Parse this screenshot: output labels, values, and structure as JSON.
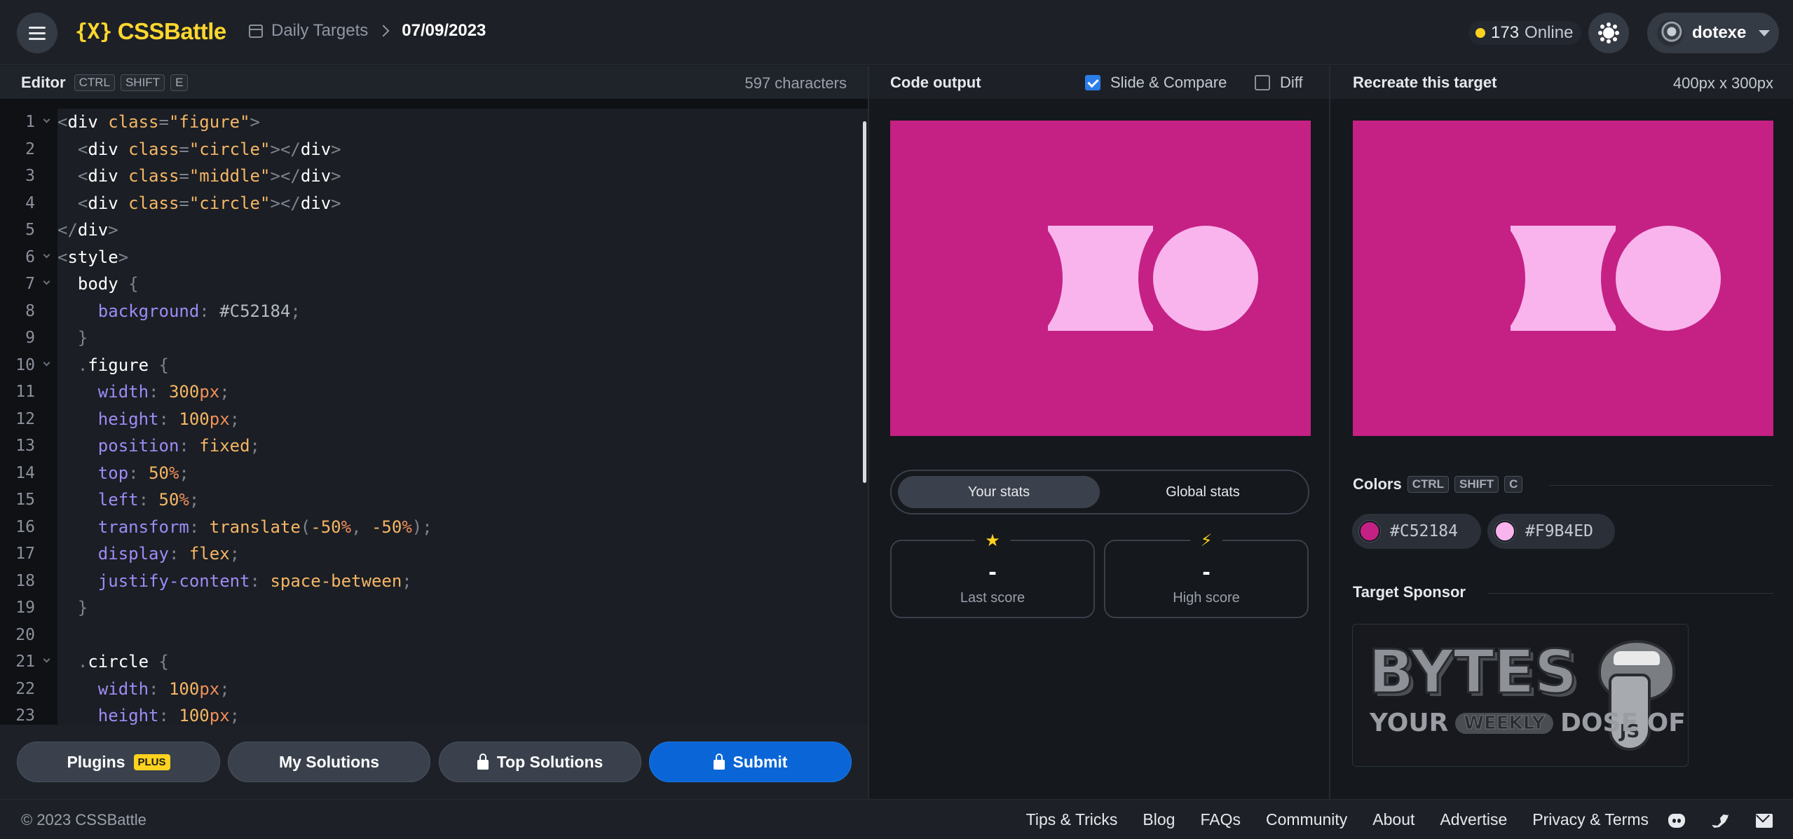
{
  "app": {
    "logo_text": "CSSBattle",
    "logo_mark": "{X}"
  },
  "header": {
    "breadcrumb_section": "Daily Targets",
    "breadcrumb_current": "07/09/2023",
    "online_count": "173",
    "online_label": "Online",
    "username": "dotexe"
  },
  "editor": {
    "title": "Editor",
    "shortcut_keys": [
      "CTRL",
      "SHIFT",
      "E"
    ],
    "char_count": "597 characters",
    "line_numbers": [
      "1",
      "2",
      "3",
      "4",
      "5",
      "6",
      "7",
      "8",
      "9",
      "10",
      "11",
      "12",
      "13",
      "14",
      "15",
      "16",
      "17",
      "18",
      "19",
      "20",
      "21",
      "22",
      "23"
    ],
    "lines": [
      {
        "tokens": [
          [
            "t-punc",
            "<"
          ],
          [
            "t-tag",
            "div "
          ],
          [
            "t-attr",
            "class"
          ],
          [
            "t-punc",
            "="
          ],
          [
            "t-str",
            "\"figure\""
          ],
          [
            "t-punc",
            ">"
          ]
        ]
      },
      {
        "tokens": [
          [
            "t-punc",
            "  <"
          ],
          [
            "t-tag",
            "div "
          ],
          [
            "t-attr",
            "class"
          ],
          [
            "t-punc",
            "="
          ],
          [
            "t-str",
            "\"circle\""
          ],
          [
            "t-punc",
            "></"
          ],
          [
            "t-tag",
            "div"
          ],
          [
            "t-punc",
            ">"
          ]
        ]
      },
      {
        "tokens": [
          [
            "t-punc",
            "  <"
          ],
          [
            "t-tag",
            "div "
          ],
          [
            "t-attr",
            "class"
          ],
          [
            "t-punc",
            "="
          ],
          [
            "t-str",
            "\"middle\""
          ],
          [
            "t-punc",
            "></"
          ],
          [
            "t-tag",
            "div"
          ],
          [
            "t-punc",
            ">"
          ]
        ]
      },
      {
        "tokens": [
          [
            "t-punc",
            "  <"
          ],
          [
            "t-tag",
            "div "
          ],
          [
            "t-attr",
            "class"
          ],
          [
            "t-punc",
            "="
          ],
          [
            "t-str",
            "\"circle\""
          ],
          [
            "t-punc",
            "></"
          ],
          [
            "t-tag",
            "div"
          ],
          [
            "t-punc",
            ">"
          ]
        ]
      },
      {
        "tokens": [
          [
            "t-punc",
            "</"
          ],
          [
            "t-tag",
            "div"
          ],
          [
            "t-punc",
            ">"
          ]
        ]
      },
      {
        "tokens": [
          [
            "t-punc",
            "<"
          ],
          [
            "t-tag",
            "style"
          ],
          [
            "t-punc",
            ">"
          ]
        ]
      },
      {
        "tokens": [
          [
            "t-sel",
            "  body "
          ],
          [
            "t-punc",
            "{"
          ]
        ]
      },
      {
        "tokens": [
          [
            "t-prop",
            "    background"
          ],
          [
            "t-punc",
            ": "
          ],
          [
            "t-hex",
            "#C52184"
          ],
          [
            "t-punc",
            ";"
          ]
        ]
      },
      {
        "tokens": [
          [
            "t-punc",
            "  }"
          ]
        ]
      },
      {
        "tokens": [
          [
            "t-punc",
            "  ."
          ],
          [
            "t-sel",
            "figure "
          ],
          [
            "t-punc",
            "{"
          ]
        ]
      },
      {
        "tokens": [
          [
            "t-prop",
            "    width"
          ],
          [
            "t-punc",
            ": "
          ],
          [
            "t-num",
            "300"
          ],
          [
            "t-unit",
            "px"
          ],
          [
            "t-punc",
            ";"
          ]
        ]
      },
      {
        "tokens": [
          [
            "t-prop",
            "    height"
          ],
          [
            "t-punc",
            ": "
          ],
          [
            "t-num",
            "100"
          ],
          [
            "t-unit",
            "px"
          ],
          [
            "t-punc",
            ";"
          ]
        ]
      },
      {
        "tokens": [
          [
            "t-prop",
            "    position"
          ],
          [
            "t-punc",
            ": "
          ],
          [
            "t-val",
            "fixed"
          ],
          [
            "t-punc",
            ";"
          ]
        ]
      },
      {
        "tokens": [
          [
            "t-prop",
            "    top"
          ],
          [
            "t-punc",
            ": "
          ],
          [
            "t-num",
            "50"
          ],
          [
            "t-unit",
            "%"
          ],
          [
            "t-punc",
            ";"
          ]
        ]
      },
      {
        "tokens": [
          [
            "t-prop",
            "    left"
          ],
          [
            "t-punc",
            ": "
          ],
          [
            "t-num",
            "50"
          ],
          [
            "t-unit",
            "%"
          ],
          [
            "t-punc",
            ";"
          ]
        ]
      },
      {
        "tokens": [
          [
            "t-prop",
            "    transform"
          ],
          [
            "t-punc",
            ": "
          ],
          [
            "t-val",
            "translate"
          ],
          [
            "t-punc",
            "("
          ],
          [
            "t-num",
            "-50"
          ],
          [
            "t-unit",
            "%"
          ],
          [
            "t-punc",
            ", "
          ],
          [
            "t-num",
            "-50"
          ],
          [
            "t-unit",
            "%"
          ],
          [
            "t-punc",
            ");"
          ]
        ]
      },
      {
        "tokens": [
          [
            "t-prop",
            "    display"
          ],
          [
            "t-punc",
            ": "
          ],
          [
            "t-val",
            "flex"
          ],
          [
            "t-punc",
            ";"
          ]
        ]
      },
      {
        "tokens": [
          [
            "t-prop",
            "    justify-content"
          ],
          [
            "t-punc",
            ": "
          ],
          [
            "t-val",
            "space-between"
          ],
          [
            "t-punc",
            ";"
          ]
        ]
      },
      {
        "tokens": [
          [
            "t-punc",
            "  }"
          ]
        ]
      },
      {
        "tokens": []
      },
      {
        "tokens": [
          [
            "t-punc",
            "  ."
          ],
          [
            "t-sel",
            "circle "
          ],
          [
            "t-punc",
            "{"
          ]
        ]
      },
      {
        "tokens": [
          [
            "t-prop",
            "    width"
          ],
          [
            "t-punc",
            ": "
          ],
          [
            "t-num",
            "100"
          ],
          [
            "t-unit",
            "px"
          ],
          [
            "t-punc",
            ";"
          ]
        ]
      },
      {
        "tokens": [
          [
            "t-prop",
            "    height"
          ],
          [
            "t-punc",
            ": "
          ],
          [
            "t-num",
            "100"
          ],
          [
            "t-unit",
            "px"
          ],
          [
            "t-punc",
            ";"
          ]
        ]
      }
    ],
    "fold_lines": [
      1,
      6,
      7,
      10,
      21
    ]
  },
  "actions": {
    "plugins_label": "Plugins",
    "plugins_badge": "PLUS",
    "my_solutions_label": "My Solutions",
    "top_solutions_label": "Top Solutions",
    "submit_label": "Submit"
  },
  "output": {
    "title": "Code output",
    "slide_compare_label": "Slide & Compare",
    "slide_compare_checked": true,
    "diff_label": "Diff",
    "diff_checked": false
  },
  "target": {
    "title": "Recreate this target",
    "dimensions": "400px x 300px"
  },
  "stats": {
    "tab_your": "Your stats",
    "tab_global": "Global stats",
    "last_score_value": "-",
    "last_score_label": "Last score",
    "high_score_value": "-",
    "high_score_label": "High score"
  },
  "colors": {
    "title": "Colors",
    "shortcut_keys": [
      "CTRL",
      "SHIFT",
      "C"
    ],
    "swatches": [
      {
        "hex": "#C52184",
        "label": "#C52184"
      },
      {
        "hex": "#F9B4ED",
        "label": "#F9B4ED"
      }
    ]
  },
  "sponsor": {
    "title": "Target Sponsor",
    "brand": "BYTES",
    "tagline_start": "YOUR",
    "tagline_pill": "WEEKLY",
    "tagline_end": "DOSE OF",
    "badge": "JS"
  },
  "footer": {
    "copyright": "© 2023 CSSBattle",
    "links": [
      "Tips & Tricks",
      "Blog",
      "FAQs",
      "Community",
      "About",
      "Advertise",
      "Privacy & Terms"
    ]
  },
  "theme": {
    "accent": "#ffd72e",
    "primary_button": "#0a66d6",
    "art_background": "#C52184",
    "art_shape": "#F9B4ED"
  }
}
